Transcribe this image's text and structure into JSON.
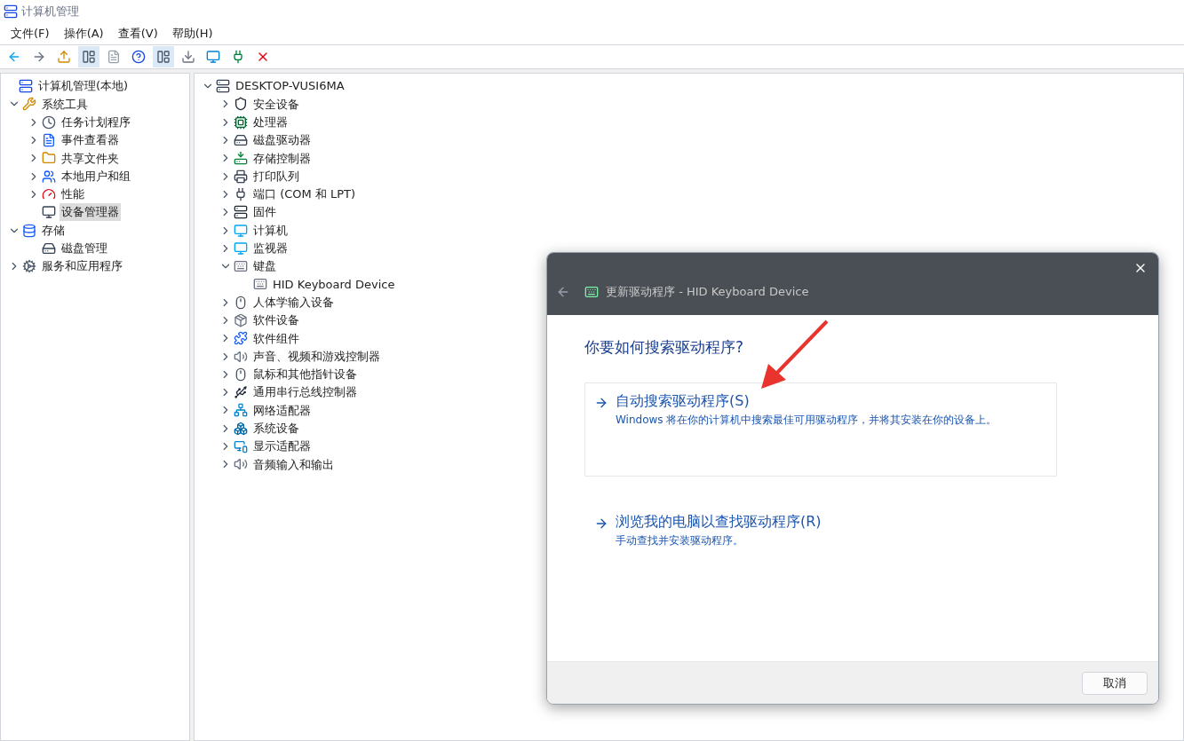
{
  "window": {
    "title": "计算机管理"
  },
  "menu": [
    "文件(F)",
    "操作(A)",
    "查看(V)",
    "帮助(H)"
  ],
  "left_tree": {
    "label": "计算机管理(本地)",
    "selected": false,
    "children": [
      {
        "label": "系统工具",
        "expanded": true,
        "selected": false,
        "children": [
          {
            "label": "任务计划程序",
            "expanded": false,
            "selected": false
          },
          {
            "label": "事件查看器",
            "expanded": false,
            "selected": false
          },
          {
            "label": "共享文件夹",
            "expanded": false,
            "selected": false
          },
          {
            "label": "本地用户和组",
            "expanded": false,
            "selected": false
          },
          {
            "label": "性能",
            "expanded": false,
            "selected": false
          },
          {
            "label": "设备管理器",
            "selected": true
          }
        ]
      },
      {
        "label": "存储",
        "expanded": true,
        "selected": false,
        "children": [
          {
            "label": "磁盘管理",
            "selected": false
          }
        ]
      },
      {
        "label": "服务和应用程序",
        "expanded": false,
        "selected": false
      }
    ]
  },
  "device_tree": {
    "label": "DESKTOP-VUSI6MA",
    "expanded": true,
    "children": [
      {
        "label": "安全设备",
        "expanded": false
      },
      {
        "label": "处理器",
        "expanded": false
      },
      {
        "label": "磁盘驱动器",
        "expanded": false
      },
      {
        "label": "存储控制器",
        "expanded": false
      },
      {
        "label": "打印队列",
        "expanded": false
      },
      {
        "label": "端口 (COM 和 LPT)",
        "expanded": false
      },
      {
        "label": "固件",
        "expanded": false
      },
      {
        "label": "计算机",
        "expanded": false
      },
      {
        "label": "监视器",
        "expanded": false
      },
      {
        "label": "键盘",
        "expanded": true,
        "children": [
          {
            "label": "HID Keyboard Device"
          }
        ]
      },
      {
        "label": "人体学输入设备",
        "expanded": false
      },
      {
        "label": "软件设备",
        "expanded": false
      },
      {
        "label": "软件组件",
        "expanded": false
      },
      {
        "label": "声音、视频和游戏控制器",
        "expanded": false
      },
      {
        "label": "鼠标和其他指针设备",
        "expanded": false
      },
      {
        "label": "通用串行总线控制器",
        "expanded": false
      },
      {
        "label": "网络适配器",
        "expanded": false
      },
      {
        "label": "系统设备",
        "expanded": false
      },
      {
        "label": "显示适配器",
        "expanded": false
      },
      {
        "label": "音频输入和输出",
        "expanded": false
      }
    ]
  },
  "dialog": {
    "title": "更新驱动程序 - HID Keyboard Device",
    "heading": "你要如何搜索驱动程序?",
    "options": [
      {
        "title": "自动搜索驱动程序(S)",
        "description": "Windows 将在你的计算机中搜索最佳可用驱动程序，并将其安装在你的设备上。",
        "hovered": true
      },
      {
        "title": "浏览我的电脑以查找驱动程序(R)",
        "description": "手动查找并安装驱动程序。",
        "hovered": false
      }
    ],
    "cancel_button": "取消"
  }
}
